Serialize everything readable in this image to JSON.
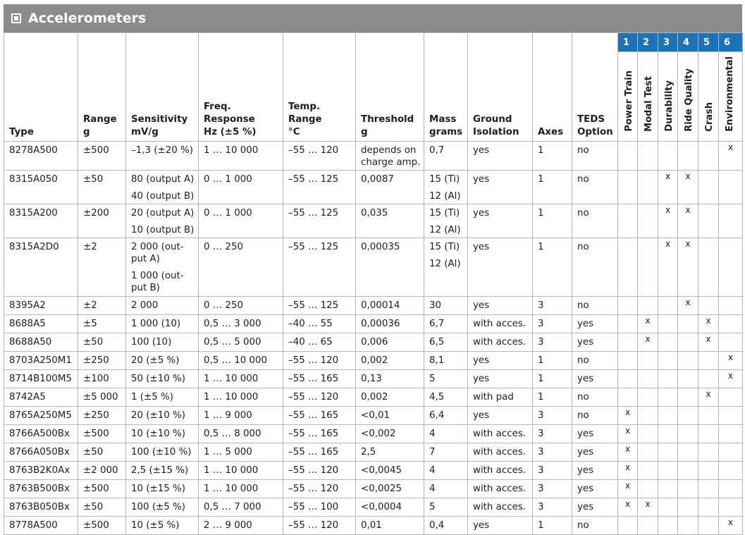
{
  "title": "Accelerometers",
  "title_icon": "square-dot-icon",
  "headers": {
    "type": "Type",
    "range": [
      "Range",
      "g"
    ],
    "sensitivity": [
      "Sensitivity",
      "mV/g"
    ],
    "freq": [
      "Freq. Response",
      "Hz (±5 %)"
    ],
    "temp": [
      "Temp. Range",
      "°C"
    ],
    "threshold": [
      "Threshold",
      "g"
    ],
    "mass": [
      "Mass",
      "grams"
    ],
    "ground": [
      "Ground",
      "Isolation"
    ],
    "axes": "Axes",
    "teds": [
      "TEDS",
      "Option"
    ]
  },
  "apps": [
    {
      "num": "1",
      "label": "Power Train"
    },
    {
      "num": "2",
      "label": "Modal Test"
    },
    {
      "num": "3",
      "label": "Durability"
    },
    {
      "num": "4",
      "label": "Ride Quality"
    },
    {
      "num": "5",
      "label": "Crash"
    },
    {
      "num": "6",
      "label": "Environmental"
    }
  ],
  "accent_color": "#1d73b9",
  "rows": [
    {
      "type": "8278A500",
      "range": "±500",
      "sens": [
        "–1,3 (±20 %)"
      ],
      "freq": "1 … 10 000",
      "temp": "–55 … 120",
      "thr": [
        "depends on",
        "charge amp."
      ],
      "mass": [
        "0,7"
      ],
      "ground": "yes",
      "axes": "1",
      "teds": "no",
      "marks": [
        "",
        "",
        "",
        "",
        "",
        "x"
      ]
    },
    {
      "type": "8315A050",
      "range": "±50",
      "sens": [
        "80 (output A)",
        "40 (output B)"
      ],
      "freq": "0 … 1 000",
      "temp": "–55 … 125",
      "thr": [
        "0,0087"
      ],
      "mass": [
        "15 (Ti)",
        "12 (Al)"
      ],
      "ground": "yes",
      "axes": "1",
      "teds": "no",
      "marks": [
        "",
        "",
        "x",
        "x",
        "",
        ""
      ]
    },
    {
      "type": "8315A200",
      "range": "±200",
      "sens": [
        "20 (output A)",
        "10 (output B)"
      ],
      "freq": "0 … 1 000",
      "temp": "–55 … 125",
      "thr": [
        "0,035"
      ],
      "mass": [
        "15 (Ti)",
        "12 (Al)"
      ],
      "ground": "yes",
      "axes": "1",
      "teds": "no",
      "marks": [
        "",
        "",
        "x",
        "x",
        "",
        ""
      ]
    },
    {
      "type": "8315A2D0",
      "range": "±2",
      "sens": [
        "2 000 (out-\nput A)",
        "1 000 (out-\nput B)"
      ],
      "freq": "0 … 250",
      "temp": "–55 … 125",
      "thr": [
        "0,00035"
      ],
      "mass": [
        "15 (Ti)",
        "12 (Al)"
      ],
      "ground": "yes",
      "axes": "1",
      "teds": "no",
      "marks": [
        "",
        "",
        "x",
        "x",
        "",
        ""
      ]
    },
    {
      "type": "8395A2",
      "range": "±2",
      "sens": [
        "2 000"
      ],
      "freq": "0 … 250",
      "temp": "–55 … 125",
      "thr": [
        "0,00014"
      ],
      "mass": [
        "30"
      ],
      "ground": "yes",
      "axes": "3",
      "teds": "no",
      "marks": [
        "",
        "",
        "",
        "x",
        "",
        ""
      ]
    },
    {
      "type": "8688A5",
      "range": "±5",
      "sens": [
        "1 000 (10)"
      ],
      "freq": "0,5 … 3 000",
      "temp": "–40 … 55",
      "thr": [
        "0,00036"
      ],
      "mass": [
        "6,7"
      ],
      "ground": "with acces.",
      "axes": "3",
      "teds": "yes",
      "marks": [
        "",
        "x",
        "",
        "",
        "x",
        ""
      ]
    },
    {
      "type": "8688A50",
      "range": "±50",
      "sens": [
        "100 (10)"
      ],
      "freq": "0,5 … 5 000",
      "temp": "–40 … 65",
      "thr": [
        "0,006"
      ],
      "mass": [
        "6,5"
      ],
      "ground": "with acces.",
      "axes": "3",
      "teds": "yes",
      "marks": [
        "",
        "x",
        "",
        "",
        "x",
        ""
      ]
    },
    {
      "type": "8703A250M1",
      "range": "±250",
      "sens": [
        "20 (±5 %)"
      ],
      "freq": "0,5 … 10 000",
      "temp": "–55 … 120",
      "thr": [
        "0,002"
      ],
      "mass": [
        "8,1"
      ],
      "ground": "yes",
      "axes": "1",
      "teds": "no",
      "marks": [
        "",
        "",
        "",
        "",
        "",
        "x"
      ]
    },
    {
      "type": "8714B100M5",
      "range": "±100",
      "sens": [
        "50 (±10 %)"
      ],
      "freq": "1 … 10 000",
      "temp": "–55 … 165",
      "thr": [
        "0,13"
      ],
      "mass": [
        "5"
      ],
      "ground": "yes",
      "axes": "1",
      "teds": "yes",
      "marks": [
        "",
        "",
        "",
        "",
        "",
        "x"
      ]
    },
    {
      "type": "8742A5",
      "range": "±5 000",
      "sens": [
        "1 (±5 %)"
      ],
      "freq": "1 … 10 000",
      "temp": "–55 … 120",
      "thr": [
        "0,002"
      ],
      "mass": [
        "4,5"
      ],
      "ground": "with pad",
      "axes": "1",
      "teds": "no",
      "marks": [
        "",
        "",
        "",
        "",
        "x",
        ""
      ]
    },
    {
      "type": "8765A250M5",
      "range": "±250",
      "sens": [
        "20 (±10 %)"
      ],
      "freq": "1 … 9 000",
      "temp": "–55 … 165",
      "thr": [
        "<0,01"
      ],
      "mass": [
        "6,4"
      ],
      "ground": "yes",
      "axes": "3",
      "teds": "no",
      "marks": [
        "x",
        "",
        "",
        "",
        "",
        ""
      ]
    },
    {
      "type": "8766A500Bx",
      "range": "±500",
      "sens": [
        "10 (±10 %)"
      ],
      "freq": "0,5 … 8 000",
      "temp": "–55 … 165",
      "thr": [
        "<0,002"
      ],
      "mass": [
        "4"
      ],
      "ground": "with acces.",
      "axes": "3",
      "teds": "yes",
      "marks": [
        "x",
        "",
        "",
        "",
        "",
        ""
      ]
    },
    {
      "type": "8766A050Bx",
      "range": "±50",
      "sens": [
        "100 (±10 %)"
      ],
      "freq": "1 … 5 000",
      "temp": "–55 … 165",
      "thr": [
        "2,5"
      ],
      "mass": [
        "7"
      ],
      "ground": "with acces.",
      "axes": "3",
      "teds": "yes",
      "marks": [
        "x",
        "",
        "",
        "",
        "",
        ""
      ]
    },
    {
      "type": "8763B2K0Ax",
      "range": "±2 000",
      "sens": [
        "2,5 (±15 %)"
      ],
      "freq": "1 … 10 000",
      "temp": "–55 … 120",
      "thr": [
        "<0,0045"
      ],
      "mass": [
        "4"
      ],
      "ground": "with acces.",
      "axes": "3",
      "teds": "yes",
      "marks": [
        "x",
        "",
        "",
        "",
        "",
        ""
      ]
    },
    {
      "type": "8763B500Bx",
      "range": "±500",
      "sens": [
        "10 (±15 %)"
      ],
      "freq": "1 … 10 000",
      "temp": "–55 … 120",
      "thr": [
        "<0,0025"
      ],
      "mass": [
        "4"
      ],
      "ground": "with acces.",
      "axes": "3",
      "teds": "yes",
      "marks": [
        "x",
        "",
        "",
        "",
        "",
        ""
      ]
    },
    {
      "type": "8763B050Bx",
      "range": "±50",
      "sens": [
        "100 (±5 %)"
      ],
      "freq": "0,5 … 7 000",
      "temp": "–55 … 100",
      "thr": [
        "<0,0004"
      ],
      "mass": [
        "5"
      ],
      "ground": "with acces.",
      "axes": "3",
      "teds": "yes",
      "marks": [
        "x",
        "x",
        "",
        "",
        "",
        ""
      ]
    },
    {
      "type": "8778A500",
      "range": "±500",
      "sens": [
        "10 (±5 %)"
      ],
      "freq": "2 … 9 000",
      "temp": "–55 … 120",
      "thr": [
        "0,01"
      ],
      "mass": [
        "0,4"
      ],
      "ground": "yes",
      "axes": "1",
      "teds": "no",
      "marks": [
        "",
        "",
        "",
        "",
        "",
        "x"
      ]
    }
  ]
}
